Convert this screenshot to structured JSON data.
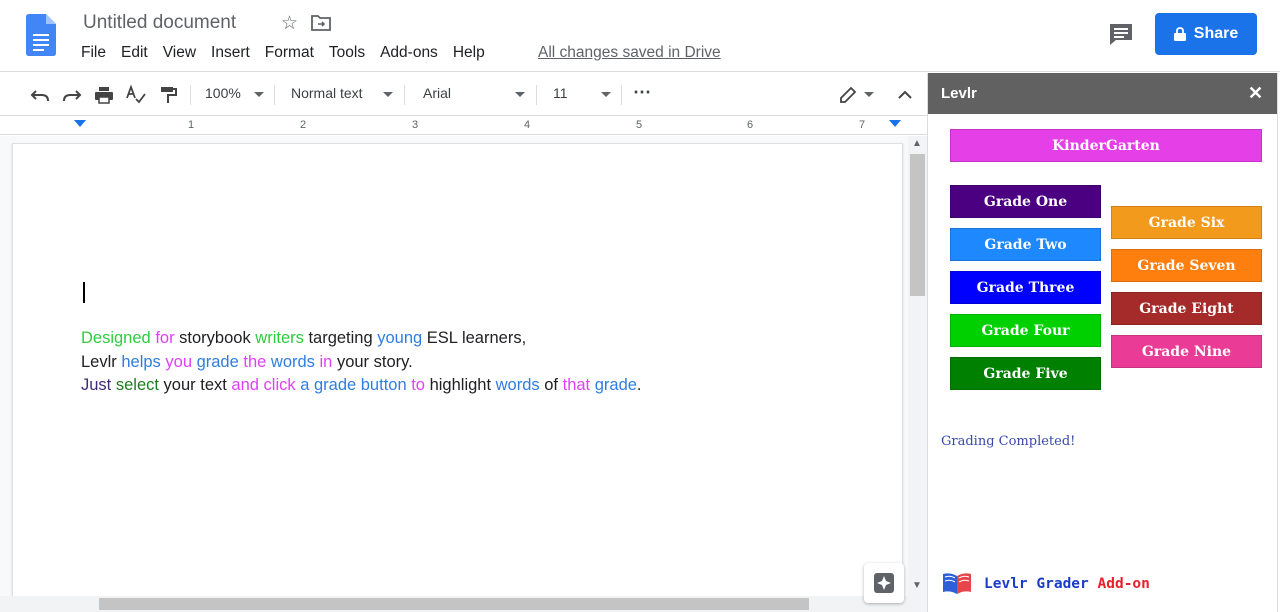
{
  "header": {
    "doc_title": "Untitled document",
    "menu": [
      "File",
      "Edit",
      "View",
      "Insert",
      "Format",
      "Tools",
      "Add-ons",
      "Help"
    ],
    "saved_status": "All changes saved in Drive",
    "share_label": "Share",
    "share_color": "#1a73e8"
  },
  "toolbar": {
    "zoom": "100%",
    "style": "Normal text",
    "font": "Arial",
    "font_size": "11",
    "more": "⋯"
  },
  "ruler": {
    "numbers": [
      "1",
      "2",
      "3",
      "4",
      "5",
      "6",
      "7"
    ]
  },
  "document": {
    "lines": [
      [
        {
          "t": "Designed ",
          "c": "#2ecc40"
        },
        {
          "t": "for ",
          "c": "#e040fb"
        },
        {
          "t": "storybook ",
          "c": "#202124"
        },
        {
          "t": "writers ",
          "c": "#2ecc40"
        },
        {
          "t": "targeting ",
          "c": "#202124"
        },
        {
          "t": "young ",
          "c": "#2f7de1"
        },
        {
          "t": "ESL learners,",
          "c": "#202124"
        }
      ],
      [
        {
          "t": "Levlr ",
          "c": "#202124"
        },
        {
          "t": "helps ",
          "c": "#2f7de1"
        },
        {
          "t": "you ",
          "c": "#e040fb"
        },
        {
          "t": "grade ",
          "c": "#2f7de1"
        },
        {
          "t": "the ",
          "c": "#e040fb"
        },
        {
          "t": "words ",
          "c": "#2f7de1"
        },
        {
          "t": "in ",
          "c": "#e040fb"
        },
        {
          "t": "your story.",
          "c": "#202124"
        }
      ],
      [
        {
          "t": "Just ",
          "c": "#3f2b7a"
        },
        {
          "t": "select ",
          "c": "#1e7d1e"
        },
        {
          "t": "your text ",
          "c": "#202124"
        },
        {
          "t": "and click ",
          "c": "#e040fb"
        },
        {
          "t": "a ",
          "c": "#2f7de1"
        },
        {
          "t": "grade button ",
          "c": "#2f7de1"
        },
        {
          "t": "to ",
          "c": "#e040fb"
        },
        {
          "t": "highlight ",
          "c": "#202124"
        },
        {
          "t": "words ",
          "c": "#2f7de1"
        },
        {
          "t": "of ",
          "c": "#202124"
        },
        {
          "t": "that ",
          "c": "#e040fb"
        },
        {
          "t": "grade",
          "c": "#2f7de1"
        },
        {
          "t": ".",
          "c": "#202124"
        }
      ]
    ]
  },
  "sidebar": {
    "title": "Levlr",
    "close": "✕",
    "kindergarten": {
      "label": "KinderGarten",
      "color": "#e540e8"
    },
    "left_grades": [
      {
        "label": "Grade One",
        "color": "#4b0082"
      },
      {
        "label": "Grade Two",
        "color": "#1e88ff"
      },
      {
        "label": "Grade Three",
        "color": "#0000ff"
      },
      {
        "label": "Grade Four",
        "color": "#00d000"
      },
      {
        "label": "Grade Five",
        "color": "#008000"
      }
    ],
    "right_grades": [
      {
        "label": "Grade Six",
        "color": "#f29a1c"
      },
      {
        "label": "Grade Seven",
        "color": "#ff7f0e"
      },
      {
        "label": "Grade Eight",
        "color": "#a52a2a"
      },
      {
        "label": "Grade Nine",
        "color": "#ea3c96"
      }
    ],
    "status": "Grading Completed!",
    "footer": {
      "name": "Levlr Grader",
      "suffix": "Add-on",
      "name_color": "#1a3cc8",
      "suffix_color": "#e8202a"
    }
  }
}
